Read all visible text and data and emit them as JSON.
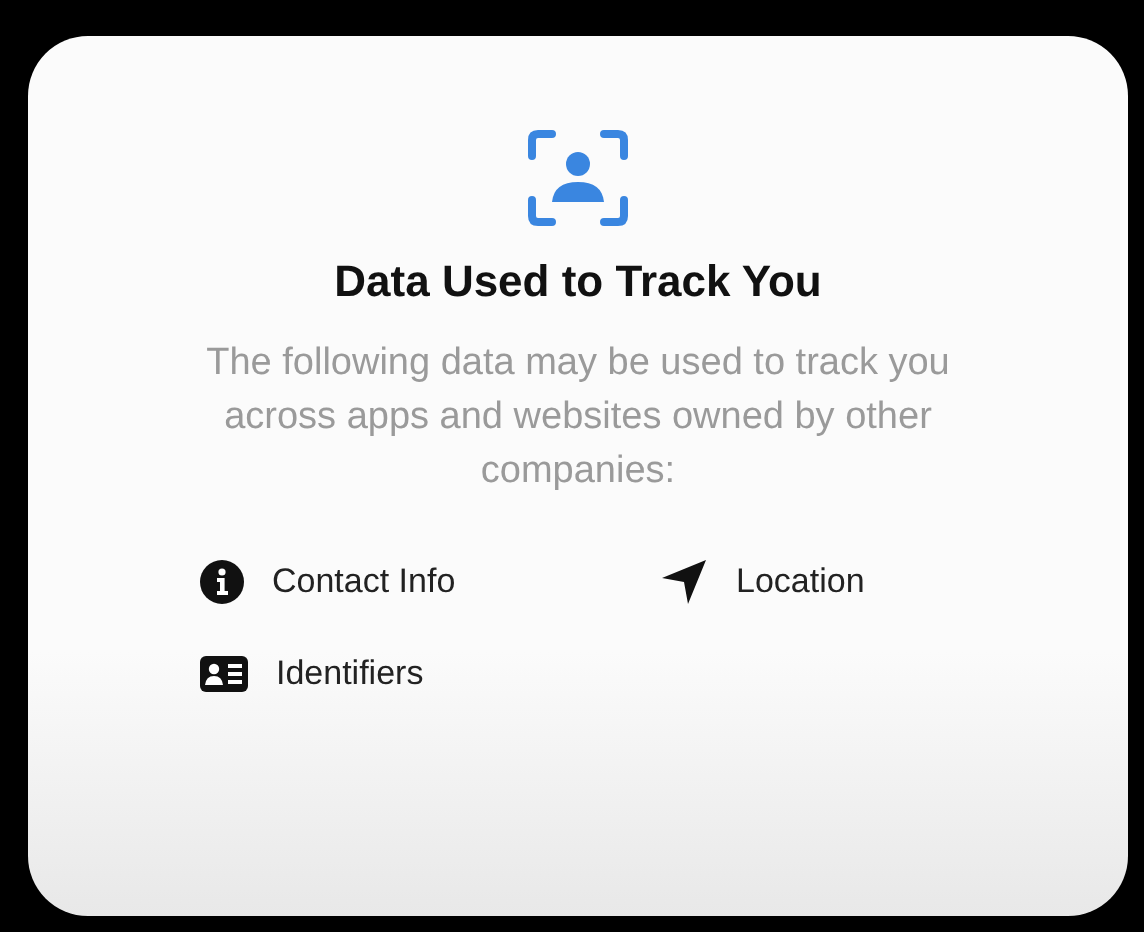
{
  "card": {
    "title": "Data Used to Track You",
    "description": "The following data may be used to track you across apps and websites owned by other companies:"
  },
  "items": [
    {
      "kind": "info",
      "label": "Contact Info"
    },
    {
      "kind": "location",
      "label": "Location"
    },
    {
      "kind": "id-card",
      "label": "Identifiers"
    }
  ]
}
